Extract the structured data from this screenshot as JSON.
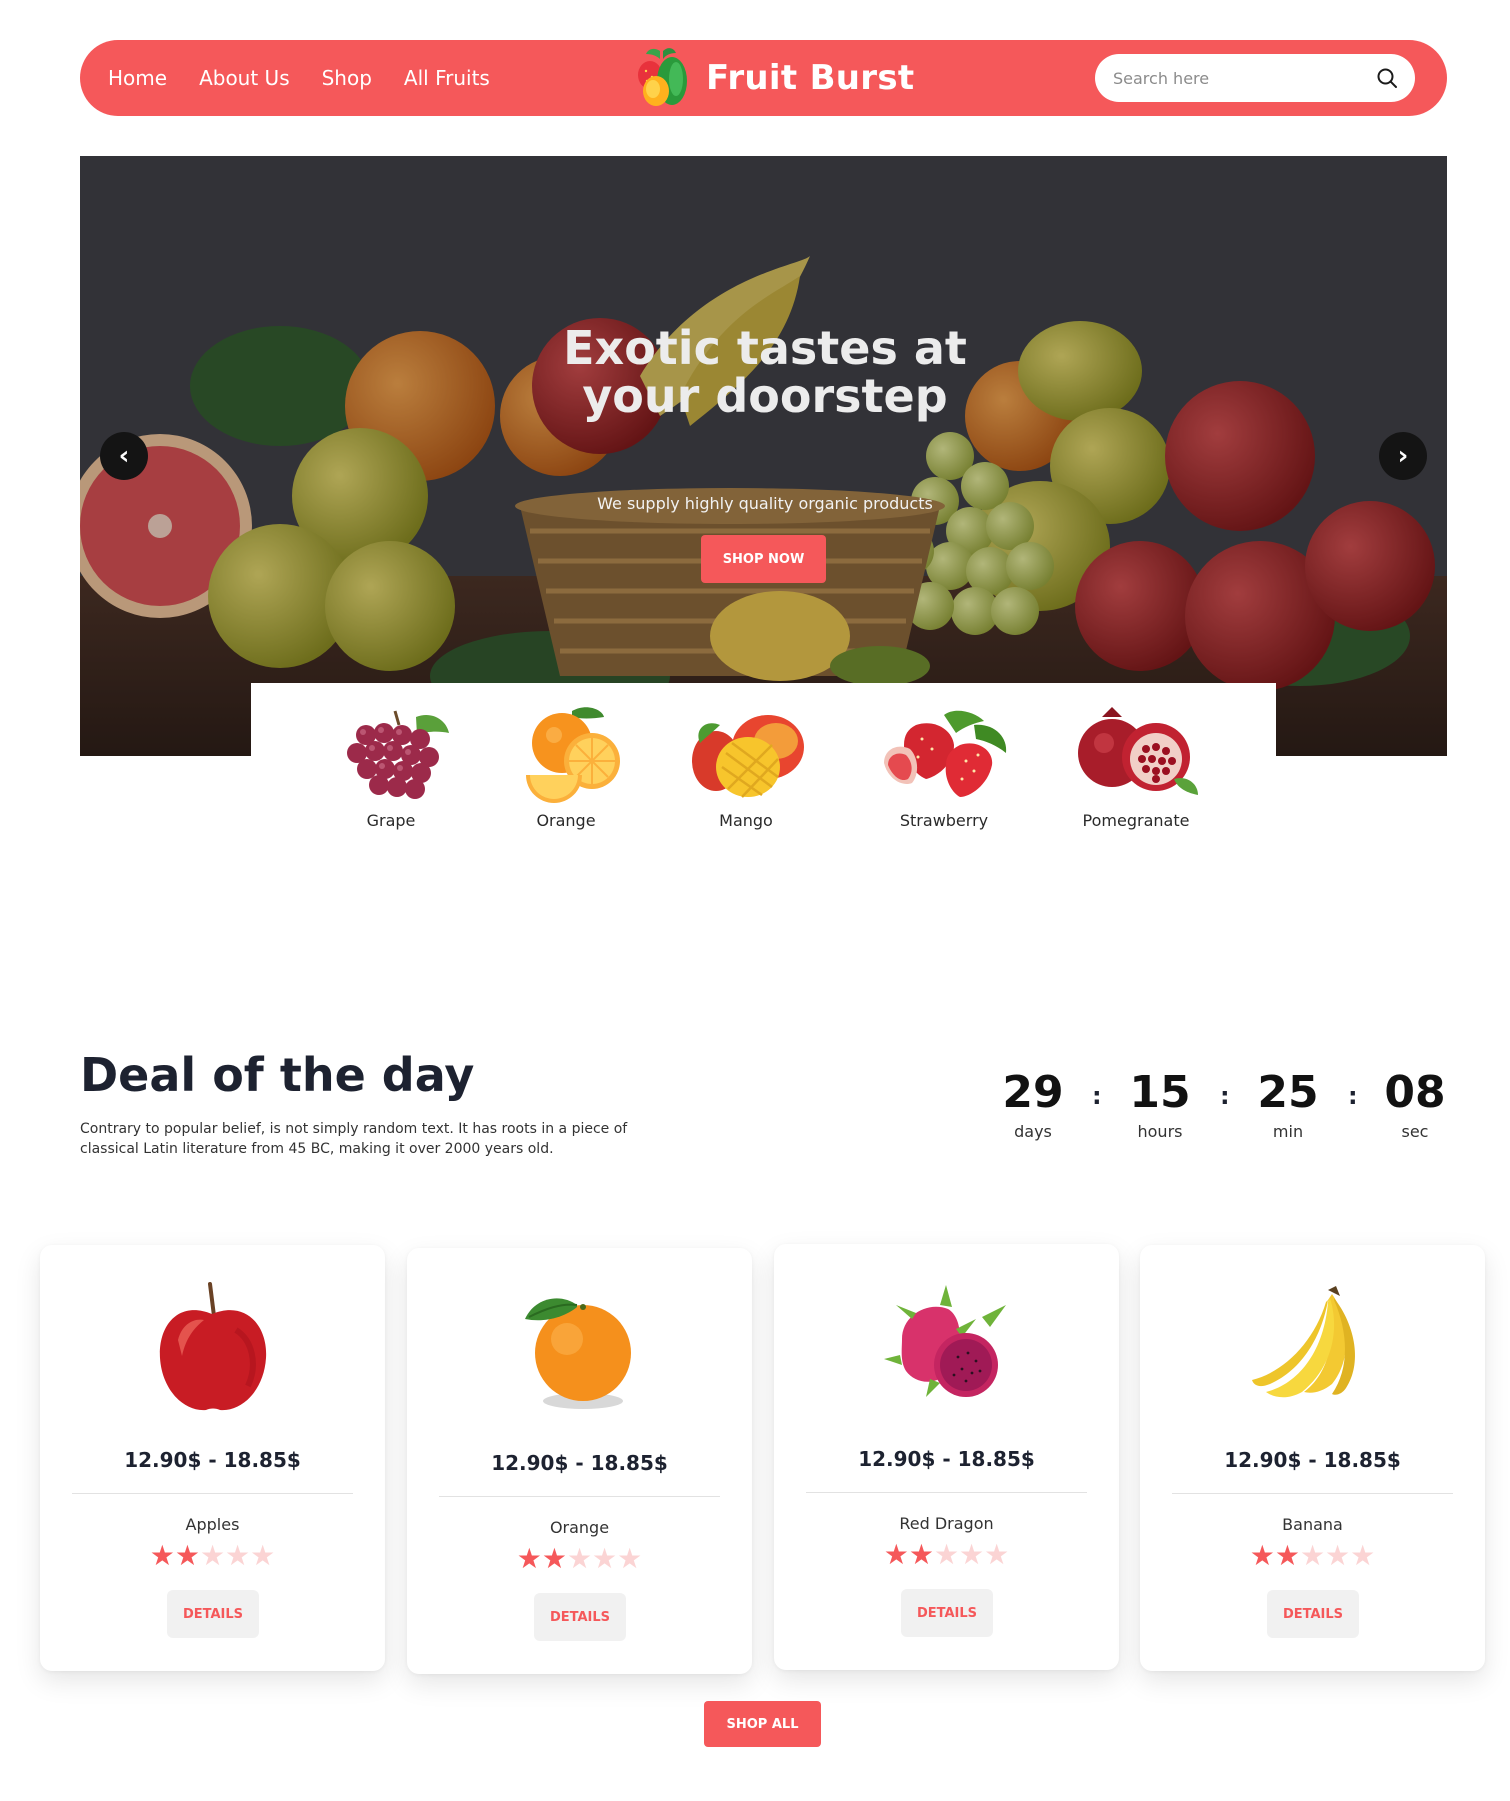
{
  "nav": {
    "links": [
      "Home",
      "About Us",
      "Shop",
      "All Fruits"
    ],
    "brand": "Fruit Burst",
    "search_placeholder": "Search here",
    "brand_color": "#f5585a"
  },
  "hero": {
    "title": "Exotic tastes at your doorstep",
    "subtitle": "We supply highly quality organic products",
    "cta": "SHOP NOW",
    "prev_icon": "chevron-left-icon",
    "next_icon": "chevron-right-icon"
  },
  "categories": [
    {
      "label": "Grape",
      "icon": "grape-icon"
    },
    {
      "label": "Orange",
      "icon": "orange-icon"
    },
    {
      "label": "Mango",
      "icon": "mango-icon"
    },
    {
      "label": "Strawberry",
      "icon": "strawberry-icon"
    },
    {
      "label": "Pomegranate",
      "icon": "pomegranate-icon"
    }
  ],
  "deal": {
    "title": "Deal of the day",
    "description": "Contrary to popular belief, is not simply random text. It has roots in a piece of classical Latin literature from 45 BC, making it over 2000 years old.",
    "countdown": [
      {
        "value": "29",
        "label": "days"
      },
      {
        "value": "15",
        "label": "hours"
      },
      {
        "value": "25",
        "label": "min"
      },
      {
        "value": "08",
        "label": "sec"
      }
    ]
  },
  "products": [
    {
      "name": "Apples",
      "price": "12.90$ - 18.85$",
      "rating": 2,
      "rating_max": 5,
      "button": "DETAILS",
      "icon": "apple-icon"
    },
    {
      "name": "Orange",
      "price": "12.90$ - 18.85$",
      "rating": 2,
      "rating_max": 5,
      "button": "DETAILS",
      "icon": "orange-icon"
    },
    {
      "name": "Red Dragon",
      "price": "12.90$ - 18.85$",
      "rating": 2,
      "rating_max": 5,
      "button": "DETAILS",
      "icon": "dragon-fruit-icon"
    },
    {
      "name": "Banana",
      "price": "12.90$ - 18.85$",
      "rating": 2,
      "rating_max": 5,
      "button": "DETAILS",
      "icon": "banana-icon"
    }
  ],
  "shop_all": "SHOP ALL"
}
